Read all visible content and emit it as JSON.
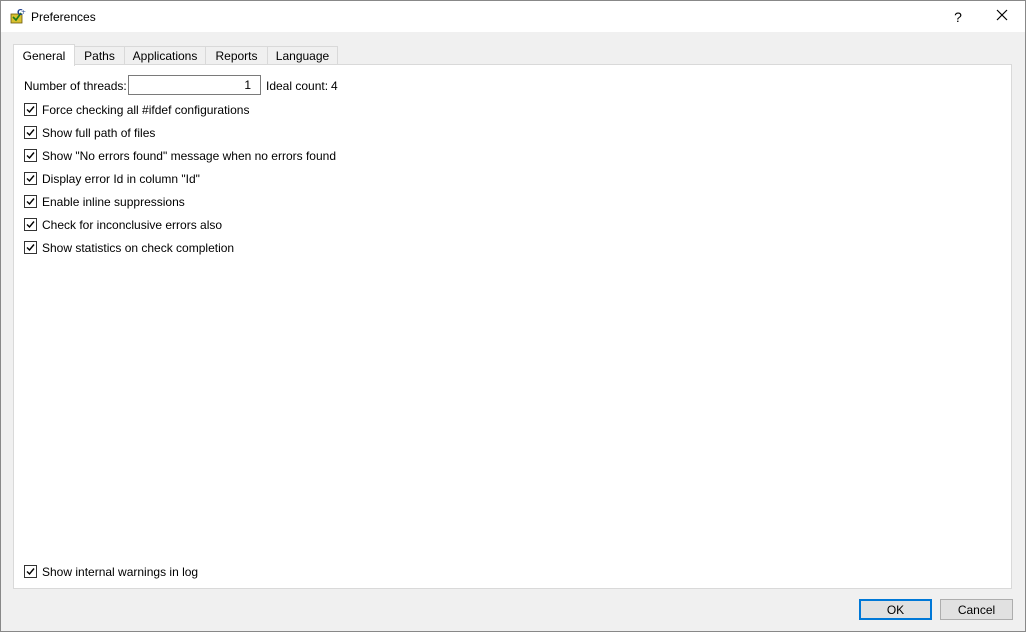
{
  "window": {
    "title": "Preferences",
    "help_label": "?"
  },
  "tabs": [
    {
      "label": "General",
      "active": true
    },
    {
      "label": "Paths",
      "active": false
    },
    {
      "label": "Applications",
      "active": false
    },
    {
      "label": "Reports",
      "active": false
    },
    {
      "label": "Language",
      "active": false
    }
  ],
  "general": {
    "threads_label": "Number of threads:",
    "threads_value": "1",
    "ideal_label": "Ideal count:",
    "ideal_value": "4",
    "options": [
      {
        "label": "Force checking all #ifdef configurations",
        "checked": true
      },
      {
        "label": "Show full path of files",
        "checked": true
      },
      {
        "label": "Show \"No errors found\" message when no errors found",
        "checked": true
      },
      {
        "label": "Display error Id in column \"Id\"",
        "checked": true
      },
      {
        "label": "Enable inline suppressions",
        "checked": true
      },
      {
        "label": "Check for inconclusive errors also",
        "checked": true
      },
      {
        "label": "Show statistics on check completion",
        "checked": true
      }
    ],
    "bottom_option": {
      "label": "Show internal warnings in log",
      "checked": true
    }
  },
  "buttons": {
    "ok": "OK",
    "cancel": "Cancel"
  }
}
